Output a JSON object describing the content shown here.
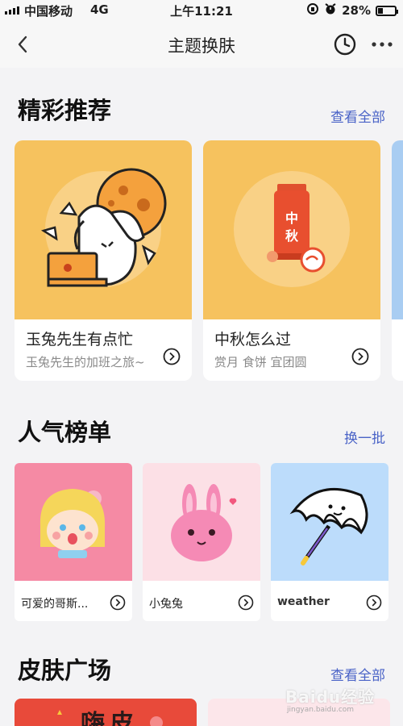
{
  "status_bar": {
    "carrier": "中国移动",
    "network": "4G",
    "time": "上午11:21",
    "battery": "28%",
    "battery_level": 0.28
  },
  "nav": {
    "title": "主题换肤",
    "icons": [
      "back-arrow-icon",
      "history-clock-icon",
      "more-dots-icon"
    ]
  },
  "featured": {
    "title": "精彩推荐",
    "link": "查看全部",
    "cards": [
      {
        "name": "玉兔先生有点忙",
        "desc": "玉兔先生的加班之旅~"
      },
      {
        "name": "中秋怎么过",
        "desc": "赏月 食饼 宜团圆",
        "badge": "中秋"
      }
    ]
  },
  "popular": {
    "title": "人气榜单",
    "link": "换一批",
    "cards": [
      {
        "name": "可爱的哥斯..."
      },
      {
        "name": "小兔兔"
      },
      {
        "name": "weather"
      }
    ]
  },
  "square": {
    "title": "皮肤广场",
    "link": "查看全部",
    "preview_text": "嗨皮"
  },
  "watermark": {
    "brand": "Baidu经验",
    "url": "jingyan.baidu.com"
  },
  "colors": {
    "link": "#4a63c7",
    "featured_bg": "#f6c25e",
    "popular_pink": "#f58aa4",
    "popular_light_pink": "#fce0e6",
    "popular_blue": "#bcdcfb"
  }
}
